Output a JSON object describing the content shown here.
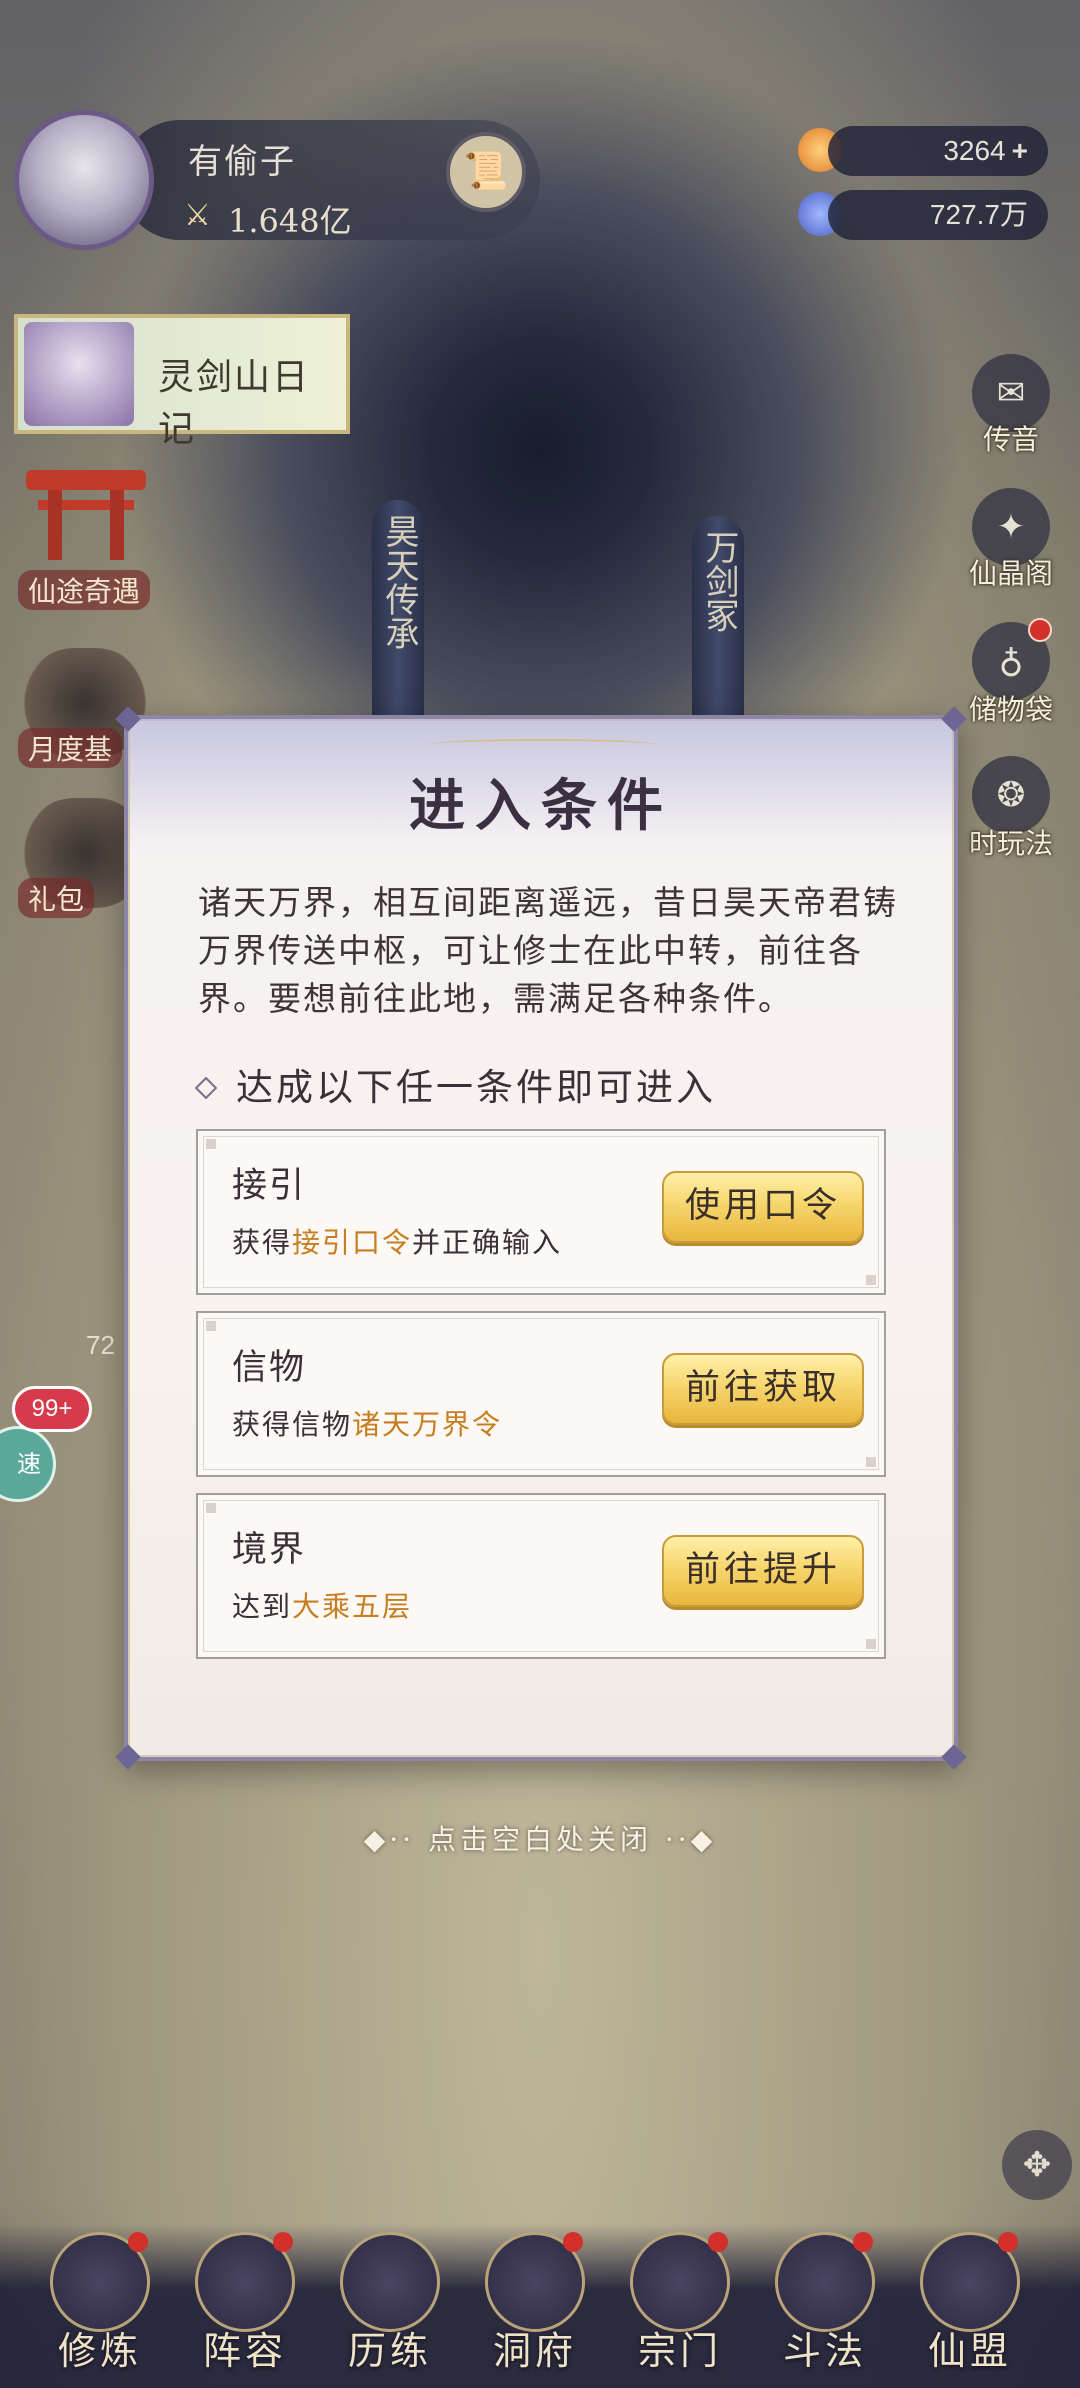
{
  "player": {
    "name": "有偷子",
    "power": "1.648亿"
  },
  "currencies": [
    {
      "value": "3264",
      "action": "+"
    },
    {
      "value": "727.7万"
    }
  ],
  "banner": {
    "label": "灵剑山日记"
  },
  "left_menu": [
    {
      "label": "仙途奇遇"
    },
    {
      "label": "月度基"
    },
    {
      "label": "礼包"
    }
  ],
  "pillars": [
    {
      "label": "昊天传承"
    },
    {
      "label": "万剑冢"
    }
  ],
  "right_menu": [
    {
      "label": "传音",
      "icon": "envelope-icon",
      "glyph": "✉"
    },
    {
      "label": "仙晶阁",
      "icon": "crystal-icon",
      "glyph": "✦"
    },
    {
      "label": "储物袋",
      "icon": "bag-icon",
      "glyph": "♁"
    },
    {
      "label": "时玩法",
      "icon": "swirl-icon",
      "glyph": "❂"
    }
  ],
  "floating": {
    "badge": "99+",
    "speed": "速",
    "side_count": "72"
  },
  "dialog": {
    "title": "进入条件",
    "description": "诸天万界，相互间距离遥远，昔日昊天帝君铸万界传送中枢，可让修士在此中转，前往各界。要想前往此地，需满足各种条件。",
    "section_heading": "达成以下任一条件即可进入",
    "conditions": [
      {
        "name": "接引",
        "desc_prefix": "获得",
        "highlight": "接引口令",
        "desc_suffix": "并正确输入",
        "button": "使用口令"
      },
      {
        "name": "信物",
        "desc_prefix": "获得信物",
        "highlight": "诸天万界令",
        "desc_suffix": "",
        "button": "前往获取"
      },
      {
        "name": "境界",
        "desc_prefix": "达到",
        "highlight": "大乘五层",
        "desc_suffix": "",
        "button": "前往提升"
      }
    ]
  },
  "close_hint": "点击空白处关闭",
  "bottom_nav": [
    {
      "label": "修炼"
    },
    {
      "label": "阵容"
    },
    {
      "label": "历练"
    },
    {
      "label": "洞府"
    },
    {
      "label": "宗门"
    },
    {
      "label": "斗法"
    },
    {
      "label": "仙盟"
    }
  ],
  "colors": {
    "highlight": "#c77e1f",
    "button_gold": "#f7d66e",
    "badge_red": "#d63a4b"
  }
}
